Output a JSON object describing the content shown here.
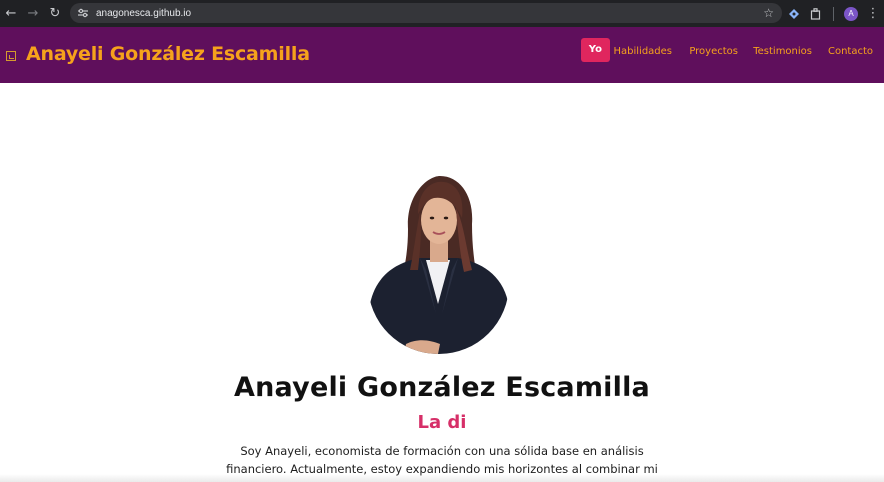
{
  "browser": {
    "url": "anagonesca.github.io",
    "avatar_letter": "A"
  },
  "header": {
    "brand": "Anayeli González Escamilla",
    "bg_color": "#5f0f5c",
    "accent_color": "#f6a21c",
    "nav": [
      {
        "label": "Yo",
        "active": true
      },
      {
        "label": "Habilidades",
        "active": false
      },
      {
        "label": "Proyectos",
        "active": false
      },
      {
        "label": "Testimonios",
        "active": false
      },
      {
        "label": "Contacto",
        "active": false
      }
    ]
  },
  "hero": {
    "name": "Anayeli González Escamilla",
    "subtitle": "La di",
    "subtitle_color": "#d62f68",
    "description": "Soy Anayeli, economista de formación con una sólida base en análisis financiero. Actualmente, estoy expandiendo mis horizontes al combinar mi"
  }
}
